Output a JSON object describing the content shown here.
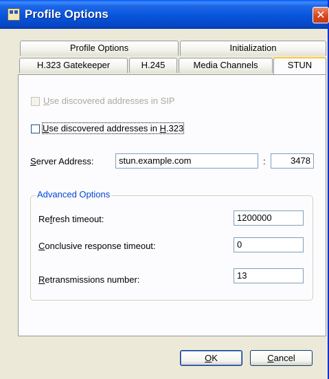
{
  "window": {
    "title": "Profile Options",
    "close_glyph": "✕"
  },
  "tabs": {
    "row1": [
      {
        "label": "Profile Options"
      },
      {
        "label": "Initialization"
      }
    ],
    "row2": [
      {
        "label": "H.323 Gatekeeper"
      },
      {
        "label": "H.245"
      },
      {
        "label": "Media Channels"
      },
      {
        "label": "STUN"
      }
    ],
    "selected": "STUN"
  },
  "stun": {
    "sip_checkbox": {
      "pre": "",
      "accel": "U",
      "post": "se discovered addresses in SIP",
      "checked": false,
      "enabled": false
    },
    "h323_checkbox": {
      "pre": "",
      "accel": "U",
      "mid": "se discovered addresses in ",
      "accel2": "H",
      "post": ".323",
      "checked": false,
      "enabled": true
    },
    "server": {
      "label_accel": "S",
      "label_rest": "erver Address:",
      "address": "stun.example.com",
      "separator": ":",
      "port": "3478"
    },
    "advanced": {
      "legend": "Advanced Options",
      "refresh": {
        "pre": "Re",
        "accel": "f",
        "post": "resh timeout:",
        "value": "1200000"
      },
      "conclusive": {
        "pre": "",
        "accel": "C",
        "post": "onclusive response timeout:",
        "value": "0"
      },
      "retrans": {
        "pre": "",
        "accel": "R",
        "post": "etransmissions number:",
        "value": "13"
      }
    }
  },
  "buttons": {
    "ok": {
      "accel": "O",
      "rest": "K"
    },
    "cancel": {
      "accel": "C",
      "rest": "ancel"
    }
  }
}
